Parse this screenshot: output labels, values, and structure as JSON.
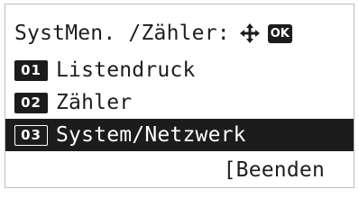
{
  "header": {
    "title": "SystMen. /Zähler:",
    "nav_icon": "four-way-arrow-icon",
    "ok_label": "OK"
  },
  "menu": {
    "items": [
      {
        "number": "01",
        "label": "Listendruck",
        "selected": false
      },
      {
        "number": "02",
        "label": "Zähler",
        "selected": false
      },
      {
        "number": "03",
        "label": "System/Netzwerk",
        "selected": true
      }
    ]
  },
  "footer": {
    "exit_label": "[Beenden"
  },
  "colors": {
    "highlight_bg": "#1c1c1c",
    "highlight_fg": "#ffffff",
    "text": "#1e1e1e"
  }
}
